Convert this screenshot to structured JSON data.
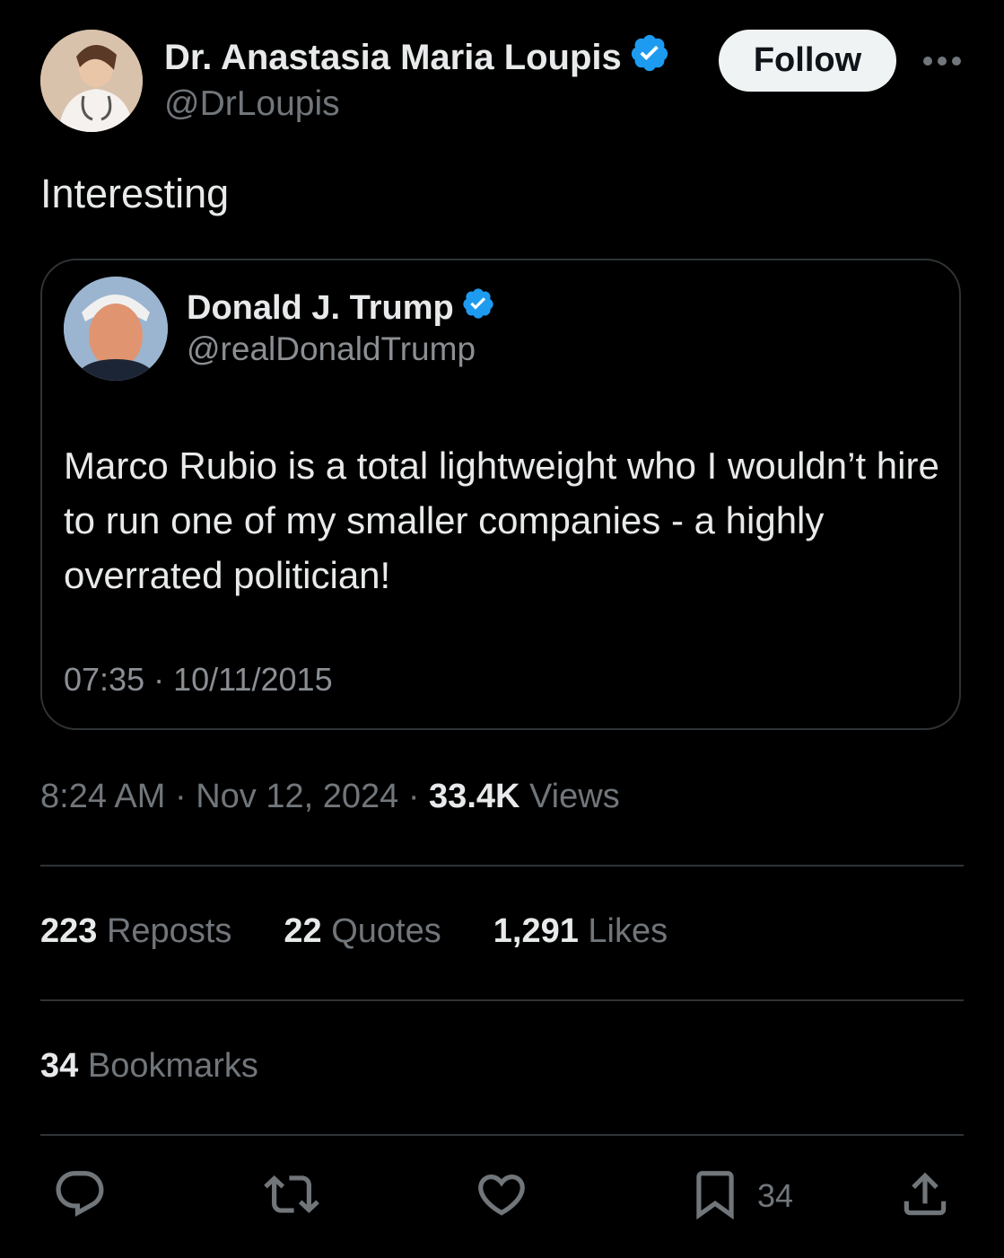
{
  "author": {
    "display_name": "Dr. Anastasia Maria Loupis",
    "handle": "@DrLoupis",
    "verified": true
  },
  "follow_label": "Follow",
  "tweet_text": "Interesting",
  "quoted": {
    "display_name": "Donald J. Trump",
    "handle": "@realDonaldTrump",
    "verified": true,
    "body": "Marco Rubio is a total lightweight who I wouldn’t hire to run one of my smaller companies - a highly overrated politician!",
    "timestamp": "07:35 · 10/11/2015"
  },
  "meta": {
    "time": "8:24 AM",
    "date": "Nov 12, 2024",
    "views_count": "33.4K",
    "views_label": "Views",
    "separator": "·"
  },
  "stats": {
    "reposts_count": "223",
    "reposts_label": "Reposts",
    "quotes_count": "22",
    "quotes_label": "Quotes",
    "likes_count": "1,291",
    "likes_label": "Likes",
    "bookmarks_count": "34",
    "bookmarks_label": "Bookmarks"
  },
  "actions": {
    "reply_icon": "reply-icon",
    "repost_icon": "repost-icon",
    "like_icon": "heart-icon",
    "bookmark_icon": "bookmark-icon",
    "bookmark_count": "34",
    "share_icon": "share-icon"
  },
  "colors": {
    "background": "#000000",
    "text_primary": "#e7e9ea",
    "text_secondary": "#71767b",
    "verified_blue": "#1d9bf0",
    "divider": "#2f3336",
    "follow_bg": "#eff3f4"
  }
}
